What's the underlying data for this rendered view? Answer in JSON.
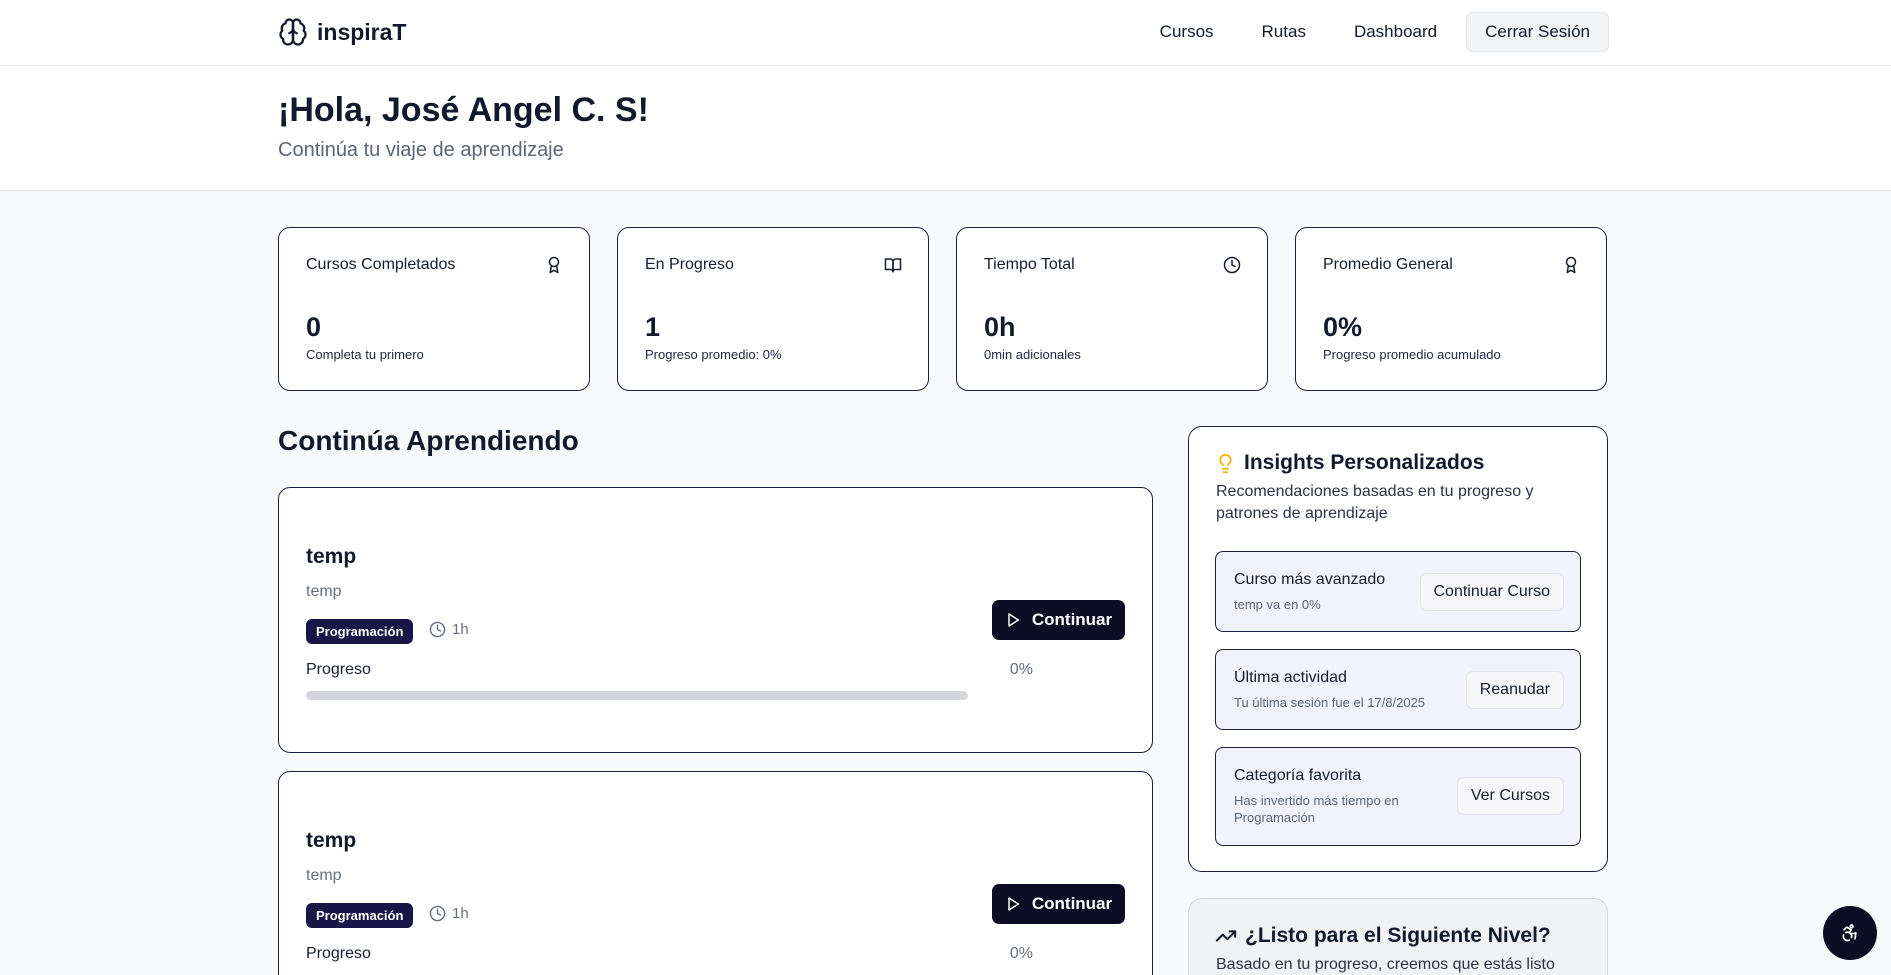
{
  "header": {
    "brand": "inspiraT",
    "nav": [
      "Cursos",
      "Rutas",
      "Dashboard"
    ],
    "logout_label": "Cerrar Sesión"
  },
  "hero": {
    "title": "¡Hola, José Angel C. S!",
    "subtitle": "Continúa tu viaje de aprendizaje"
  },
  "stats": [
    {
      "title": "Cursos Completados",
      "value": "0",
      "note": "Completa tu primero",
      "icon": "award-icon"
    },
    {
      "title": "En Progreso",
      "value": "1",
      "note": "Progreso promedio: 0%",
      "icon": "book-open-icon"
    },
    {
      "title": "Tiempo Total",
      "value": "0h",
      "note": "0min adicionales",
      "icon": "clock-icon"
    },
    {
      "title": "Promedio General",
      "value": "0%",
      "note": "Progreso promedio acumulado",
      "icon": "award-icon"
    }
  ],
  "continue_section": {
    "title": "Continúa Aprendiendo",
    "courses": [
      {
        "title": "temp",
        "description": "temp",
        "category": "Programación",
        "duration": "1h",
        "progress_label": "Progreso",
        "progress_percent": "0%",
        "progress_value": 0,
        "button_label": "Continuar"
      },
      {
        "title": "temp",
        "description": "temp",
        "category": "Programación",
        "duration": "1h",
        "progress_label": "Progreso",
        "progress_percent": "0%",
        "progress_value": 0,
        "button_label": "Continuar"
      }
    ]
  },
  "insights": {
    "title": "Insights Personalizados",
    "subtitle": "Recomendaciones basadas en tu progreso y patrones de aprendizaje",
    "items": [
      {
        "title": "Curso más avanzado",
        "description": "temp va en 0%",
        "button": "Continuar Curso"
      },
      {
        "title": "Última actividad",
        "description": "Tu última sesión fue el 17/8/2025",
        "button": "Reanudar"
      },
      {
        "title": "Categoría favorita",
        "description": "Has invertido más tiempo en Programación",
        "button": "Ver Cursos"
      }
    ]
  },
  "next_level": {
    "title": "¿Listo para el Siguiente Nivel?",
    "subtitle": "Basado en tu progreso, creemos que estás listo"
  },
  "colors": {
    "accent": "#1a1547",
    "button_dark": "#0e0c25",
    "insight_bg": "#f2f2fc",
    "lightbulb": "#f4b400"
  }
}
